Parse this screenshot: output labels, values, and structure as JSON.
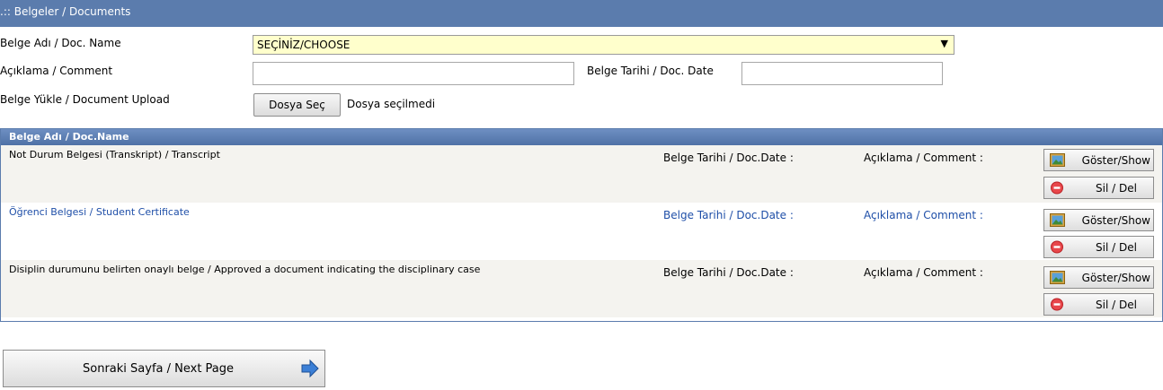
{
  "section": {
    "title": ".:: Belgeler / Documents"
  },
  "form": {
    "doc_name_label": "Belge Adı / Doc. Name",
    "doc_name_value": "SEÇİNİZ/CHOOSE",
    "comment_label": "Açıklama / Comment",
    "comment_value": "",
    "doc_date_label": "Belge Tarihi / Doc. Date",
    "doc_date_value": "",
    "upload_label": "Belge Yükle / Document Upload",
    "file_button": "Dosya Seç",
    "file_status": "Dosya seçilmedi"
  },
  "grid": {
    "header": "Belge Adı / Doc.Name",
    "rows": [
      {
        "name": "Not Durum Belgesi (Transkript) / Transcript",
        "date_label": "Belge Tarihi / Doc.Date :",
        "comment_label": "Açıklama / Comment :",
        "show": "Göster/Show",
        "del": "Sil / Del"
      },
      {
        "name": "Öğrenci Belgesi / Student Certificate",
        "date_label": "Belge Tarihi / Doc.Date :",
        "comment_label": "Açıklama / Comment :",
        "show": "Göster/Show",
        "del": "Sil / Del"
      },
      {
        "name": "Disiplin durumunu belirten onaylı belge / Approved a document indicating the disciplinary case",
        "date_label": "Belge Tarihi / Doc.Date :",
        "comment_label": "Açıklama / Comment :",
        "show": "Göster/Show",
        "del": "Sil / Del"
      }
    ]
  },
  "footer": {
    "next_label": "Sonraki Sayfa / Next Page"
  },
  "icons": {
    "show": "image-icon",
    "delete": "minus-circle-icon",
    "next": "arrow-right-icon"
  },
  "colors": {
    "header_bg": "#5b7cad",
    "select_bg": "#ffffcc",
    "link_blue": "#1f4fa8"
  }
}
